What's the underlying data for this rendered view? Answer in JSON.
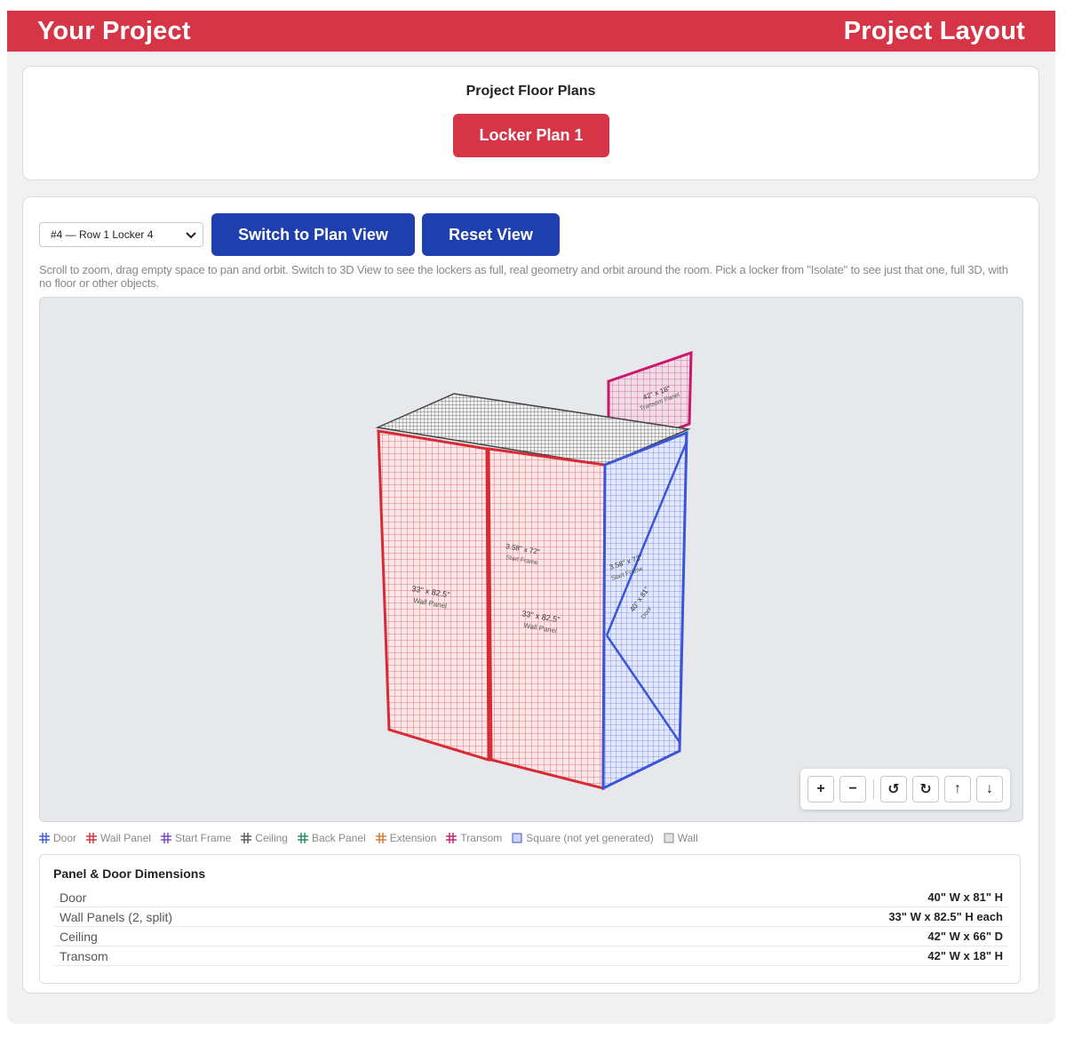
{
  "header": {
    "title": "Your Project",
    "right_title": "Project Layout"
  },
  "floor_plans": {
    "title": "Project Floor Plans",
    "plan_button": "Locker Plan 1"
  },
  "toolbar": {
    "isolate_value": "#4 — Row 1 Locker 4",
    "switch_view": "Switch to Plan View",
    "reset_view": "Reset View"
  },
  "hint": "Scroll to zoom, drag empty space to pan and orbit. Switch to 3D View to see the lockers as full, real geometry and orbit around the room. Pick a locker from \"Isolate\" to see just that one, full 3D, with no floor or other objects.",
  "viewport": {
    "labels": {
      "wall_left": "33\" x 82.5\"",
      "wall_left_sub": "Wall Panel",
      "wall_right": "33\" x 82.5\"",
      "wall_right_sub": "Wall Panel",
      "middle": "3.58\" x 72\"",
      "middle_sub": "Start Frame",
      "side_top": "3.58\" x 72\"",
      "side_top_sub": "Start Frame",
      "door": "40\" x 81\"",
      "door_sub": "Door",
      "transom": "42\" x 18\"",
      "transom_sub": "Transom Panel"
    },
    "colors": {
      "wall": "#d62b35",
      "door": "#3a55d8",
      "transom": "#c8186b",
      "ceiling": "#555555"
    }
  },
  "controls": {
    "zoom_in": "+",
    "zoom_out": "−",
    "rotate_left": "↺",
    "rotate_right": "↻",
    "up": "↑",
    "down": "↓"
  },
  "legend": [
    {
      "label": "Door",
      "color": "#3a55d8",
      "icon": "grid-icon"
    },
    {
      "label": "Wall Panel",
      "color": "#d62b35",
      "icon": "grid-icon"
    },
    {
      "label": "Start Frame",
      "color": "#7b3fc4",
      "icon": "grid-icon"
    },
    {
      "label": "Ceiling",
      "color": "#555555",
      "icon": "grid-icon"
    },
    {
      "label": "Back Panel",
      "color": "#1f8a5b",
      "icon": "grid-icon"
    },
    {
      "label": "Extension",
      "color": "#d2782a",
      "icon": "grid-icon"
    },
    {
      "label": "Transom",
      "color": "#c8186b",
      "icon": "grid-icon"
    },
    {
      "label": "Square (not yet generated)",
      "color": "#3a55d8",
      "icon": "square-icon"
    },
    {
      "label": "Wall",
      "color": "#888888",
      "icon": "square-icon"
    }
  ],
  "dimensions": {
    "title": "Panel & Door Dimensions",
    "rows": [
      {
        "label": "Door",
        "value": "40\" W x 81\" H"
      },
      {
        "label": "Wall Panels (2, split)",
        "value": "33\" W x 82.5\" H each"
      },
      {
        "label": "Ceiling",
        "value": "42\" W x 66\" D"
      },
      {
        "label": "Transom",
        "value": "42\" W x 18\" H"
      }
    ]
  }
}
